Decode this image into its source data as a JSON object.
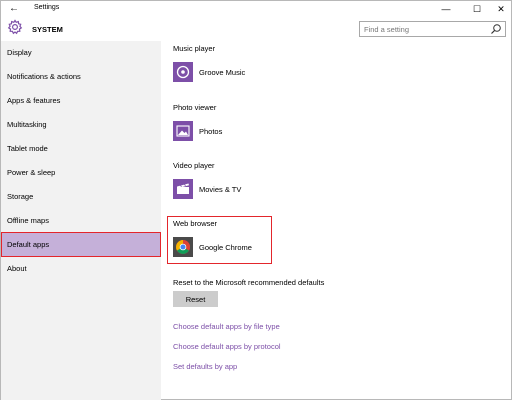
{
  "titlebar": {
    "back_icon": "back-arrow-icon",
    "title": "Settings",
    "minimize": "—",
    "maximize": "☐",
    "close": "✕"
  },
  "header": {
    "icon": "gear-icon",
    "section_title": "SYSTEM",
    "search_placeholder": "Find a setting"
  },
  "sidebar": {
    "items": [
      {
        "label": "Display"
      },
      {
        "label": "Notifications & actions"
      },
      {
        "label": "Apps & features"
      },
      {
        "label": "Multitasking"
      },
      {
        "label": "Tablet mode"
      },
      {
        "label": "Power & sleep"
      },
      {
        "label": "Storage"
      },
      {
        "label": "Offline maps"
      },
      {
        "label": "Default apps",
        "selected": true
      },
      {
        "label": "About"
      }
    ]
  },
  "defaults": [
    {
      "category": "Music player",
      "app": "Groove Music",
      "icon": "groove-music-icon"
    },
    {
      "category": "Photo viewer",
      "app": "Photos",
      "icon": "photos-icon"
    },
    {
      "category": "Video player",
      "app": "Movies & TV",
      "icon": "movies-tv-icon"
    },
    {
      "category": "Web browser",
      "app": "Google Chrome",
      "icon": "chrome-icon"
    }
  ],
  "reset": {
    "text": "Reset to the Microsoft recommended defaults",
    "button_label": "Reset"
  },
  "links": [
    {
      "label": "Choose default apps by file type"
    },
    {
      "label": "Choose default apps by protocol"
    },
    {
      "label": "Set defaults by app"
    }
  ],
  "colors": {
    "accent": "#7d4fa8",
    "selected_bg": "#c5b0d9",
    "highlight": "#e3262c"
  }
}
